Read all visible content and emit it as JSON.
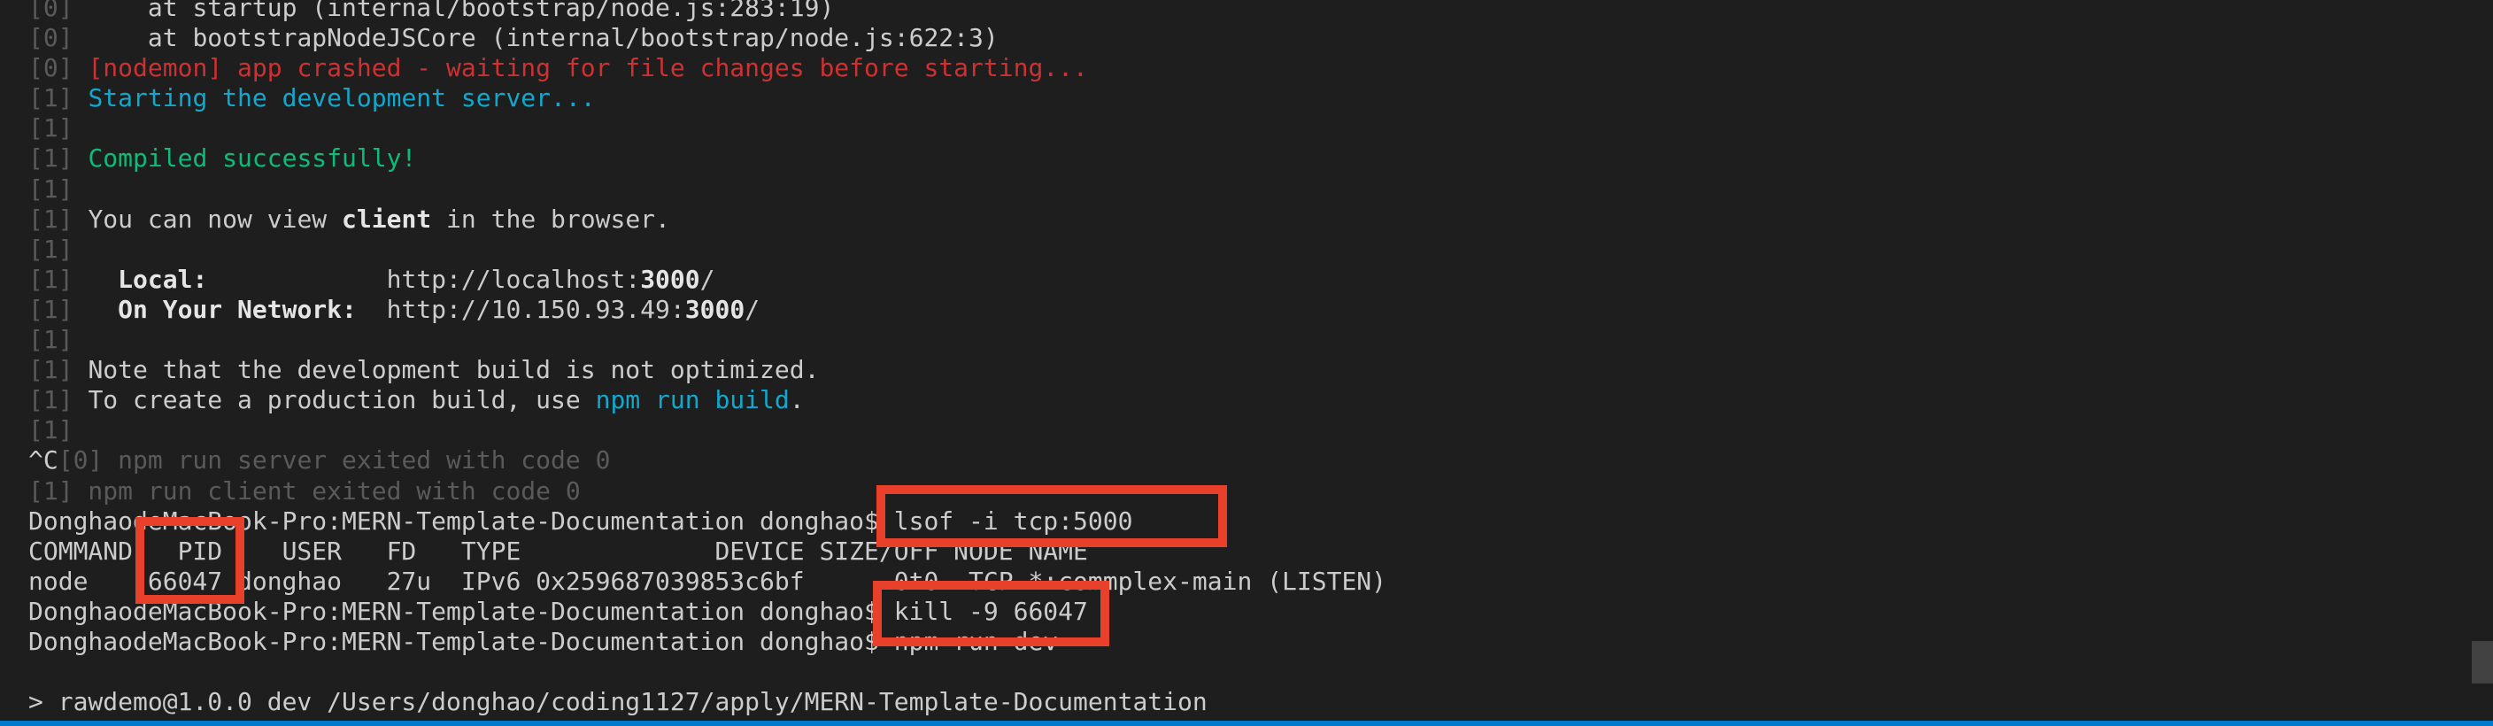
{
  "colors": {
    "background": "#1e1e1e",
    "text": "#cccccc",
    "dim": "#5a5a5a",
    "error": "#cd3131",
    "info": "#11a8cd",
    "success": "#0dbc79",
    "highlight_box": "#e8402a",
    "status_bar": "#007acc"
  },
  "terminal": {
    "lines": [
      {
        "segments": [
          {
            "t": "[0] ",
            "s": "dim"
          },
          {
            "t": "    at startup (internal/bootstrap/node.js:283:19)",
            "s": "plain"
          }
        ]
      },
      {
        "segments": [
          {
            "t": "[0] ",
            "s": "dim"
          },
          {
            "t": "    at bootstrapNodeJSCore (internal/bootstrap/node.js:622:3)",
            "s": "plain"
          }
        ]
      },
      {
        "segments": [
          {
            "t": "[0] ",
            "s": "dim"
          },
          {
            "t": "[nodemon] app crashed - waiting for file changes before starting...",
            "s": "red"
          }
        ]
      },
      {
        "segments": [
          {
            "t": "[1] ",
            "s": "dim"
          },
          {
            "t": "Starting the development server...",
            "s": "cyan"
          }
        ]
      },
      {
        "segments": [
          {
            "t": "[1]",
            "s": "dim"
          }
        ]
      },
      {
        "segments": [
          {
            "t": "[1] ",
            "s": "dim"
          },
          {
            "t": "Compiled successfully!",
            "s": "green"
          }
        ]
      },
      {
        "segments": [
          {
            "t": "[1]",
            "s": "dim"
          }
        ]
      },
      {
        "segments": [
          {
            "t": "[1] ",
            "s": "dim"
          },
          {
            "t": "You can now view ",
            "s": "plain"
          },
          {
            "t": "client",
            "s": "bold"
          },
          {
            "t": " in the browser.",
            "s": "plain"
          }
        ]
      },
      {
        "segments": [
          {
            "t": "[1]",
            "s": "dim"
          }
        ]
      },
      {
        "segments": [
          {
            "t": "[1] ",
            "s": "dim"
          },
          {
            "t": "  ",
            "s": "plain"
          },
          {
            "t": "Local:",
            "s": "bold"
          },
          {
            "t": "            http://localhost:",
            "s": "plain"
          },
          {
            "t": "3000",
            "s": "bold"
          },
          {
            "t": "/",
            "s": "plain"
          }
        ]
      },
      {
        "segments": [
          {
            "t": "[1] ",
            "s": "dim"
          },
          {
            "t": "  ",
            "s": "plain"
          },
          {
            "t": "On Your Network:",
            "s": "bold"
          },
          {
            "t": "  http://10.150.93.49:",
            "s": "plain"
          },
          {
            "t": "3000",
            "s": "bold"
          },
          {
            "t": "/",
            "s": "plain"
          }
        ]
      },
      {
        "segments": [
          {
            "t": "[1]",
            "s": "dim"
          }
        ]
      },
      {
        "segments": [
          {
            "t": "[1] ",
            "s": "dim"
          },
          {
            "t": "Note that the development build is not optimized.",
            "s": "plain"
          }
        ]
      },
      {
        "segments": [
          {
            "t": "[1] ",
            "s": "dim"
          },
          {
            "t": "To create a production build, use ",
            "s": "plain"
          },
          {
            "t": "npm run build",
            "s": "cyan"
          },
          {
            "t": ".",
            "s": "plain"
          }
        ]
      },
      {
        "segments": [
          {
            "t": "[1]",
            "s": "dim"
          }
        ]
      },
      {
        "segments": [
          {
            "t": "^C",
            "s": "plain"
          },
          {
            "t": "[0] npm run server exited with code 0",
            "s": "dim"
          }
        ]
      },
      {
        "segments": [
          {
            "t": "[1] npm run client exited with code 0",
            "s": "dim"
          }
        ]
      },
      {
        "segments": [
          {
            "t": "DonghaodeMacBook-Pro:MERN-Template-Documentation donghao$ ",
            "s": "plain"
          },
          {
            "t": "lsof -i tcp:5000",
            "s": "plain"
          }
        ]
      },
      {
        "segments": [
          {
            "t": "COMMAND   PID    USER   FD   TYPE             DEVICE SIZE/OFF NODE NAME",
            "s": "plain"
          }
        ]
      },
      {
        "segments": [
          {
            "t": "node    66047 donghao   27u  IPv6 0x259687039853c6bf      0t0  TCP *:commplex-main (LISTEN)",
            "s": "plain"
          }
        ]
      },
      {
        "segments": [
          {
            "t": "DonghaodeMacBook-Pro:MERN-Template-Documentation donghao$ ",
            "s": "plain"
          },
          {
            "t": "kill -9 66047",
            "s": "plain"
          }
        ]
      },
      {
        "segments": [
          {
            "t": "DonghaodeMacBook-Pro:MERN-Template-Documentation donghao$ ",
            "s": "plain"
          },
          {
            "t": "npm run dev",
            "s": "plain"
          }
        ]
      },
      {
        "segments": []
      },
      {
        "segments": [
          {
            "t": "> rawdemo@1.0.0 dev /Users/donghao/coding1127/apply/MERN-Template-Documentation",
            "s": "plain"
          }
        ]
      }
    ]
  }
}
